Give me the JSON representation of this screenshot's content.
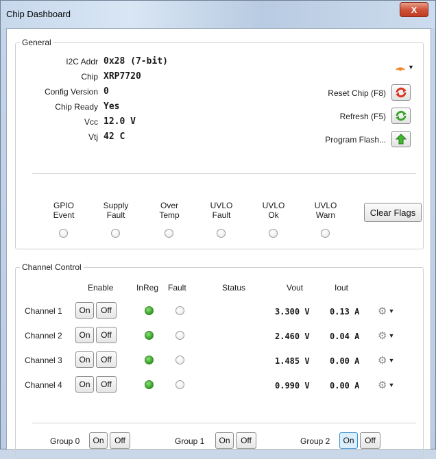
{
  "window": {
    "title": "Chip Dashboard",
    "close_label": "X"
  },
  "general": {
    "legend": "General",
    "info": [
      {
        "label": "I2C Addr",
        "value": "0x28 (7-bit)"
      },
      {
        "label": "Chip",
        "value": "XRP7720"
      },
      {
        "label": "Config Version",
        "value": "0"
      },
      {
        "label": "Chip Ready",
        "value": "Yes"
      },
      {
        "label": "Vcc",
        "value": "12.0 V"
      },
      {
        "label": "Vtj",
        "value": "42 C"
      }
    ],
    "actions": [
      {
        "label": "Reset Chip (F8)",
        "icon": "reset-icon"
      },
      {
        "label": "Refresh (F5)",
        "icon": "refresh-icon"
      },
      {
        "label": "Program Flash...",
        "icon": "upload-arrow-icon"
      }
    ],
    "flags": [
      {
        "label": "GPIO\nEvent",
        "lit": false
      },
      {
        "label": "Supply\nFault",
        "lit": false
      },
      {
        "label": "Over\nTemp",
        "lit": false
      },
      {
        "label": "UVLO\nFault",
        "lit": false
      },
      {
        "label": "UVLO\nOk",
        "lit": false
      },
      {
        "label": "UVLO\nWarn",
        "lit": false
      }
    ],
    "clear_flags_label": "Clear Flags"
  },
  "channel_control": {
    "legend": "Channel Control",
    "headers": {
      "enable": "Enable",
      "inreg": "InReg",
      "fault": "Fault",
      "status": "Status",
      "vout": "Vout",
      "iout": "Iout"
    },
    "on_label": "On",
    "off_label": "Off",
    "channels": [
      {
        "name": "Channel 1",
        "inreg": true,
        "fault": false,
        "status": "",
        "vout": "3.300 V",
        "iout": "0.13 A"
      },
      {
        "name": "Channel 2",
        "inreg": true,
        "fault": false,
        "status": "",
        "vout": "2.460 V",
        "iout": "0.04 A"
      },
      {
        "name": "Channel 3",
        "inreg": true,
        "fault": false,
        "status": "",
        "vout": "1.485 V",
        "iout": "0.00 A"
      },
      {
        "name": "Channel 4",
        "inreg": true,
        "fault": false,
        "status": "",
        "vout": "0.990 V",
        "iout": "0.00 A"
      }
    ],
    "groups": [
      {
        "name": "Group 0",
        "on_pressed": false
      },
      {
        "name": "Group 1",
        "on_pressed": false
      },
      {
        "name": "Group 2",
        "on_pressed": true
      }
    ]
  }
}
